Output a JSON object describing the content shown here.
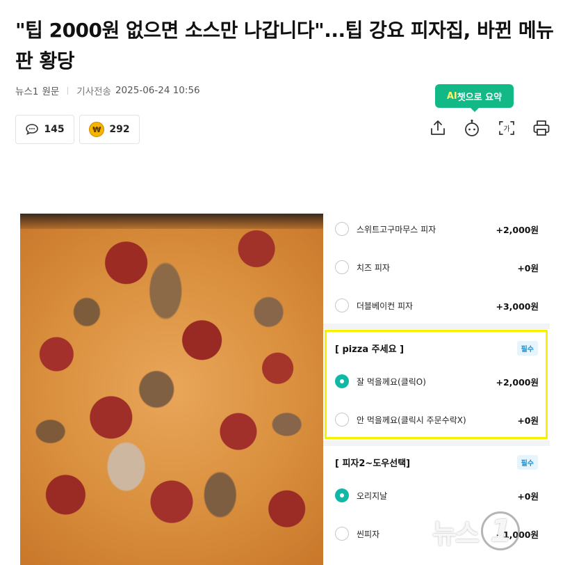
{
  "article": {
    "headline": "\"팁 2000원 없으면 소스만 나갑니다\"...팁 강요 피자집, 바뀐 메뉴판 황당",
    "source": "뉴스1",
    "original_label": "원문",
    "sent_label": "기사전송",
    "datetime": "2025-06-24 10:56"
  },
  "actions": {
    "comment_count": "145",
    "reaction_count": "292",
    "ai_summary_prefix": "AI",
    "ai_summary_label": "챗으로 요약",
    "share_icon": "share-icon",
    "bot_icon": "chatbot-icon",
    "font_icon": "font-size-icon",
    "print_icon": "print-icon"
  },
  "menu": {
    "options_top": [
      {
        "name": "스위트고구마무스 피자",
        "price": "+2,000원",
        "selected": false
      },
      {
        "name": "치즈 피자",
        "price": "+0원",
        "selected": false
      },
      {
        "name": "더블베이컨 피자",
        "price": "+3,000원",
        "selected": false
      }
    ],
    "tip_section": {
      "title": "[ pizza 주세요 ]",
      "badge": "필수",
      "options": [
        {
          "name": "잘 먹을께요(클릭O)",
          "price": "+2,000원",
          "selected": true
        },
        {
          "name": "안 먹을께요(클릭시 주문수락X)",
          "price": "+0원",
          "selected": false
        }
      ]
    },
    "dough_section": {
      "title": "[ 피자2~도우선택]",
      "badge": "필수",
      "options": [
        {
          "name": "오리지날",
          "price": "+0원",
          "selected": true
        },
        {
          "name": "씬피자",
          "price": "+1,000원",
          "selected": false
        }
      ]
    },
    "highlight_color": "#f5f100",
    "accent_color": "#12b8a6"
  },
  "watermark": {
    "text": "뉴스",
    "numeral": "1"
  }
}
